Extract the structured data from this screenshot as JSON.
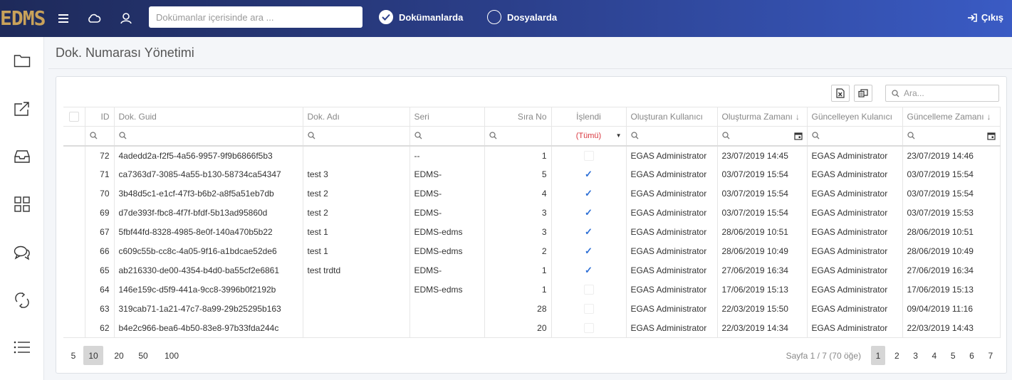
{
  "header": {
    "logo": "EDMS",
    "search_placeholder": "Dokümanlar içerisinde ara ...",
    "radio_documents": "Dokümanlarda",
    "radio_files": "Dosyalarda",
    "logout": "Çıkış"
  },
  "page": {
    "title": "Dok. Numarası Yönetimi"
  },
  "grid": {
    "search_placeholder": "Ara...",
    "columns": {
      "id": "ID",
      "guid": "Dok. Guid",
      "name": "Dok. Adı",
      "series": "Seri",
      "seq": "Sıra No",
      "processed": "İşlendi",
      "created_by": "Oluşturan Kullanıcı",
      "created_at": "Oluşturma Zamanı",
      "updated_by": "Güncelleyen Kulanıcı",
      "updated_at": "Güncelleme Zamanı"
    },
    "processed_filter": "(Tümü)",
    "rows": [
      {
        "id": "72",
        "guid": "4adedd2a-f2f5-4a56-9957-9f9b6866f5b3",
        "name": "",
        "series": "--",
        "seq": "1",
        "processed": false,
        "created_by": "EGAS Administrator",
        "created_at": "23/07/2019 14:45",
        "updated_by": "EGAS Administrator",
        "updated_at": "23/07/2019 14:46"
      },
      {
        "id": "71",
        "guid": "ca7363d7-3085-4a55-b130-58734ca54347",
        "name": "test 3",
        "series": "EDMS-",
        "seq": "5",
        "processed": true,
        "created_by": "EGAS Administrator",
        "created_at": "03/07/2019 15:54",
        "updated_by": "EGAS Administrator",
        "updated_at": "03/07/2019 15:54"
      },
      {
        "id": "70",
        "guid": "3b48d5c1-e1cf-47f3-b6b2-a8f5a51eb7db",
        "name": "test 2",
        "series": "EDMS-",
        "seq": "4",
        "processed": true,
        "created_by": "EGAS Administrator",
        "created_at": "03/07/2019 15:54",
        "updated_by": "EGAS Administrator",
        "updated_at": "03/07/2019 15:54"
      },
      {
        "id": "69",
        "guid": "d7de393f-fbc8-4f7f-bfdf-5b13ad95860d",
        "name": "test 2",
        "series": "EDMS-",
        "seq": "3",
        "processed": true,
        "created_by": "EGAS Administrator",
        "created_at": "03/07/2019 15:54",
        "updated_by": "EGAS Administrator",
        "updated_at": "03/07/2019 15:53"
      },
      {
        "id": "67",
        "guid": "5fbf44fd-8328-4985-8e0f-140a470b5b22",
        "name": "test 1",
        "series": "EDMS-edms",
        "seq": "3",
        "processed": true,
        "created_by": "EGAS Administrator",
        "created_at": "28/06/2019 10:51",
        "updated_by": "EGAS Administrator",
        "updated_at": "28/06/2019 10:51"
      },
      {
        "id": "66",
        "guid": "c609c55b-cc8c-4a05-9f16-a1bdcae52de6",
        "name": "test 1",
        "series": "EDMS-edms",
        "seq": "2",
        "processed": true,
        "created_by": "EGAS Administrator",
        "created_at": "28/06/2019 10:49",
        "updated_by": "EGAS Administrator",
        "updated_at": "28/06/2019 10:49"
      },
      {
        "id": "65",
        "guid": "ab216330-de00-4354-b4d0-ba55cf2e6861",
        "name": "test trdtd",
        "series": "EDMS-",
        "seq": "1",
        "processed": true,
        "created_by": "EGAS Administrator",
        "created_at": "27/06/2019 16:34",
        "updated_by": "EGAS Administrator",
        "updated_at": "27/06/2019 16:34"
      },
      {
        "id": "64",
        "guid": "146e159c-d5f9-441a-9cc8-3996b0f2192b",
        "name": "",
        "series": "EDMS-edms",
        "seq": "1",
        "processed": false,
        "created_by": "EGAS Administrator",
        "created_at": "17/06/2019 15:13",
        "updated_by": "EGAS Administrator",
        "updated_at": "17/06/2019 15:13"
      },
      {
        "id": "63",
        "guid": "319cab71-1a21-47c7-8a99-29b25295b163",
        "name": "",
        "series": "",
        "seq": "28",
        "processed": false,
        "created_by": "EGAS Administrator",
        "created_at": "22/03/2019 15:50",
        "updated_by": "EGAS Administrator",
        "updated_at": "09/04/2019 11:16"
      },
      {
        "id": "62",
        "guid": "b4e2c966-bea6-4b50-83e8-97b33fda244c",
        "name": "",
        "series": "",
        "seq": "20",
        "processed": false,
        "created_by": "EGAS Administrator",
        "created_at": "22/03/2019 14:34",
        "updated_by": "EGAS Administrator",
        "updated_at": "22/03/2019 14:43"
      }
    ]
  },
  "pager": {
    "sizes": [
      "5",
      "10",
      "20",
      "50",
      "100"
    ],
    "active_size": "10",
    "info": "Sayfa 1 / 7 (70 öğe)",
    "pages": [
      "1",
      "2",
      "3",
      "4",
      "5",
      "6",
      "7"
    ],
    "active_page": "1"
  },
  "colors": {
    "checkmark": "#2d6fd6",
    "filter_red": "#d9363e",
    "logo_gold": "#c9a25a"
  }
}
